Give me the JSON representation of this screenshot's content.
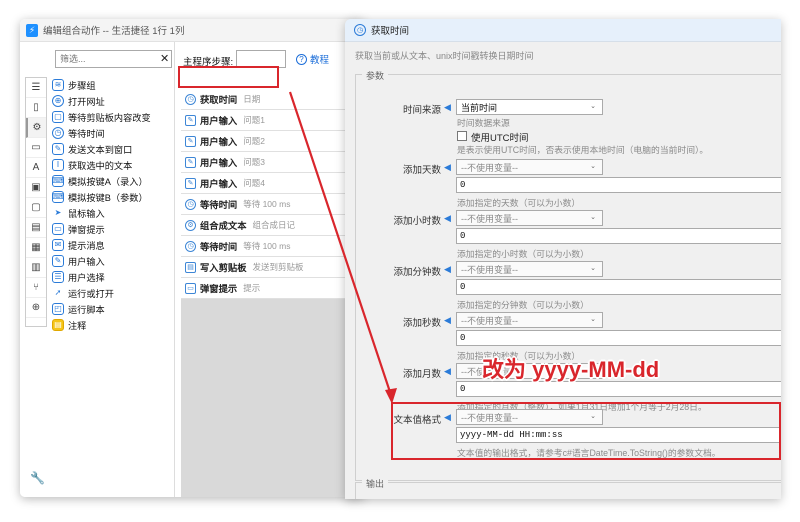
{
  "main_window": {
    "title": "编辑组合动作 -- 生活捷径 1行 1列"
  },
  "left_panel": {
    "filter_placeholder": "筛选...",
    "clear_symbol": "✕",
    "rail_icons": [
      "list-icon",
      "bookmark-icon",
      "gear-icon",
      "window-icon",
      "text-icon",
      "image-icon",
      "clipboard-icon",
      "document-icon",
      "windows-icon",
      "grid-icon",
      "branch-icon",
      "globe-icon"
    ],
    "steps": [
      {
        "label": "步骤组",
        "icon": "layers-icon"
      },
      {
        "label": "打开网址",
        "icon": "globe-icon"
      },
      {
        "label": "等待剪贴板内容改变",
        "icon": "clipboard-wait-icon"
      },
      {
        "label": "等待时间",
        "icon": "clock-icon"
      },
      {
        "label": "发送文本到窗口",
        "icon": "send-text-icon"
      },
      {
        "label": "获取选中的文本",
        "icon": "cursor-text-icon"
      },
      {
        "label": "模拟按键A（录入）",
        "icon": "keyboard-icon"
      },
      {
        "label": "模拟按键B（参数）",
        "icon": "keyboard-icon"
      },
      {
        "label": "鼠标输入",
        "icon": "mouse-pointer-icon"
      },
      {
        "label": "弹窗提示",
        "icon": "popup-icon"
      },
      {
        "label": "提示消息",
        "icon": "message-icon"
      },
      {
        "label": "用户输入",
        "icon": "user-input-icon"
      },
      {
        "label": "用户选择",
        "icon": "user-select-icon"
      },
      {
        "label": "运行或打开",
        "icon": "run-icon"
      },
      {
        "label": "运行脚本",
        "icon": "script-icon"
      },
      {
        "label": "注释",
        "icon": "note-icon"
      }
    ]
  },
  "middle_panel": {
    "main_steps_label": "主程序步骤:",
    "tutorial_label": "教程",
    "flow": [
      {
        "name": "获取时间",
        "sub": "日期",
        "icon": "clock-icon"
      },
      {
        "name": "用户输入",
        "sub": "问题1",
        "icon": "user-input-icon"
      },
      {
        "name": "用户输入",
        "sub": "问题2",
        "icon": "user-input-icon"
      },
      {
        "name": "用户输入",
        "sub": "问题3",
        "icon": "user-input-icon"
      },
      {
        "name": "用户输入",
        "sub": "问题4",
        "icon": "user-input-icon"
      },
      {
        "name": "等待时间",
        "sub": "等待 100 ms",
        "icon": "clock-icon"
      },
      {
        "name": "组合成文本",
        "sub": "组合成日记",
        "icon": "gear-icon"
      },
      {
        "name": "等待时间",
        "sub": "等待 100 ms",
        "icon": "clock-icon"
      },
      {
        "name": "写入剪贴板",
        "sub": "发送到剪贴板",
        "icon": "clipboard-icon"
      },
      {
        "name": "弹窗提示",
        "sub": "提示",
        "icon": "popup-icon"
      }
    ]
  },
  "dialog": {
    "title": "获取时间",
    "description": "获取当前或从文本、unix时间戳转换日期时间",
    "params_legend": "参数",
    "output_legend": "输出",
    "time_source": {
      "label": "时间来源",
      "value": "当前时间",
      "hint": "时间数据来源",
      "utc_label": "使用UTC时间",
      "utc_checked": false,
      "utc_hint": "是表示使用UTC时间，否表示使用本地时间（电脑的当前时间）。"
    },
    "fields": [
      {
        "label": "添加天数",
        "select": "--不使用变量--",
        "value": "0",
        "hint": "添加指定的天数（可以为小数）"
      },
      {
        "label": "添加小时数",
        "select": "--不使用变量--",
        "value": "0",
        "hint": "添加指定的小时数（可以为小数）"
      },
      {
        "label": "添加分钟数",
        "select": "--不使用变量--",
        "value": "0",
        "hint": "添加指定的分钟数（可以为小数）"
      },
      {
        "label": "添加秒数",
        "select": "--不使用变量--",
        "value": "0",
        "hint": "添加指定的秒数（可以为小数）"
      },
      {
        "label": "添加月数",
        "select": "--不使用变量--",
        "value": "0",
        "hint": "添加指定的月数（整数），如果1月31日增加1个月等于2月28日。"
      }
    ],
    "format": {
      "label": "文本值格式",
      "select": "--不使用变量--",
      "value": "yyyy-MM-dd HH:mm:ss",
      "hint": "文本值的输出格式，请参考c#语言DateTime.ToString()的参数文档。"
    }
  },
  "annotation": {
    "text": "改为 yyyy-MM-dd",
    "color": "#d9262c"
  }
}
